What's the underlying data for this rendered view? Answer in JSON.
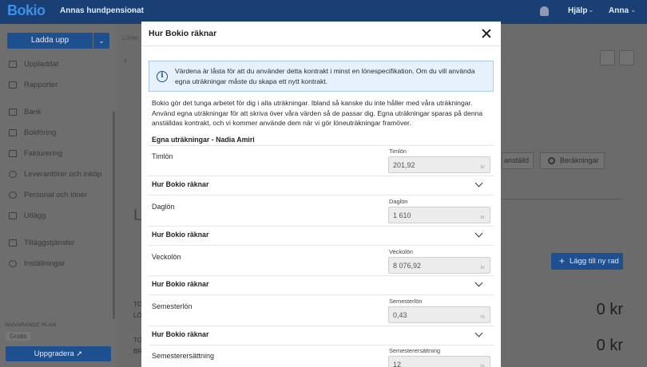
{
  "header": {
    "logo": "Bokio",
    "company": "Annas hundpensionat",
    "help": "Hjälp",
    "user": "Anna"
  },
  "sidebar": {
    "upload_label": "Ladda upp",
    "items": [
      {
        "label": "Uppladdat",
        "icon": "folder-icon"
      },
      {
        "label": "Rapporter",
        "icon": "chart-icon"
      },
      {
        "label": "Bank",
        "icon": "bank-icon"
      },
      {
        "label": "Bokföring",
        "icon": "book-icon"
      },
      {
        "label": "Fakturering",
        "icon": "invoice-icon"
      },
      {
        "label": "Leverantörer och inköp",
        "icon": "supplier-icon"
      },
      {
        "label": "Personal och löner",
        "icon": "people-icon"
      },
      {
        "label": "Utlägg",
        "icon": "card-icon"
      },
      {
        "label": "Tilläggstjänster",
        "icon": "addon-icon"
      },
      {
        "label": "Inställningar",
        "icon": "gear-icon"
      }
    ],
    "plan_caption": "NUVARANDE PLAN",
    "plan_name": "Gratis",
    "upgrade_label": "Uppgradera"
  },
  "background": {
    "breadcrumb": "Löner",
    "anstalld_button": "anställd",
    "berakningar_button": "Beräkningar",
    "add_row_button": "Lägg till ny rad",
    "total_1": "0 kr",
    "total_2": "0 kr",
    "left_1a": "TO",
    "left_1b": "LÖ",
    "left_2a": "TO",
    "left_2b": "BR",
    "big_letter": "L"
  },
  "modal": {
    "title": "Hur Bokio räknar",
    "info": "Värdena är låsta för att du använder detta kontrakt i minst en lönespecifikation. Om du vill använda egna uträkningar måste du skapa ett nytt kontrakt.",
    "intro": "Bokio gör det tunga arbetet för dig i alla uträkningar. Ibland så kanske du inte håller med våra uträkningar. Använd egna uträkningar för att skriva över våra värden så de passar dig. Egna uträkningar sparas på denna anställdas kontrakt, och vi kommer använde dem när vi gör löneuträkningar framöver.",
    "section_title": "Egna uträkningar - Nadia Amiri",
    "accordion_label": "Hur Bokio räknar",
    "rows": [
      {
        "label": "Timlön",
        "field_label": "Timlön",
        "value": "201,92",
        "unit": "kr"
      },
      {
        "label": "Daglön",
        "field_label": "Daglön",
        "value": "1 610",
        "unit": "kr"
      },
      {
        "label": "Veckolön",
        "field_label": "Veckolön",
        "value": "8 076,92",
        "unit": "kr"
      },
      {
        "label": "Semesterlön",
        "field_label": "Semesterlön",
        "value": "0,43",
        "unit": "%"
      },
      {
        "label": "Semesterersättning",
        "field_label": "Semesterersättning",
        "value": "12",
        "unit": "%"
      }
    ]
  }
}
